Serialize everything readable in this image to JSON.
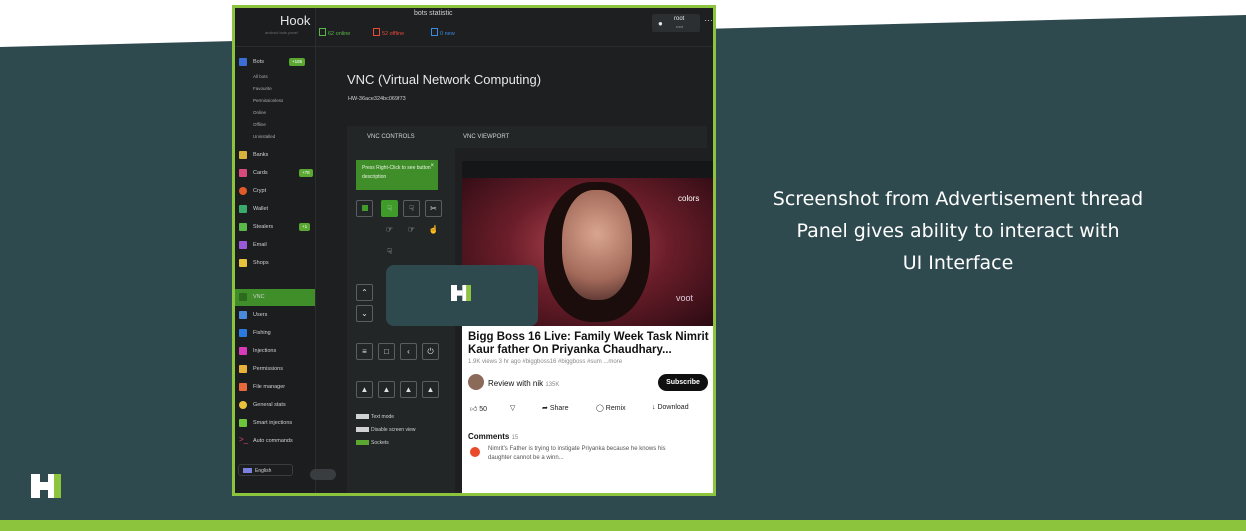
{
  "caption": {
    "line1": "Screenshot from Advertisement thread",
    "line2": "Panel gives ability to interact with",
    "line3": "UI Interface"
  },
  "colors": {
    "background": "#2f4a4f",
    "accent": "#8cc43e",
    "panel": "#1d1f20",
    "active": "#3f8e2a"
  },
  "app": {
    "name": "Hook",
    "subtitle": "android bots panel"
  },
  "topbar": {
    "stats_title": "bots statistic",
    "online": "62 online",
    "offline": "52 offline",
    "new": "0 new",
    "user": "root",
    "user_sub": "root"
  },
  "sidebar": {
    "bots_label": "Bots",
    "bots_badge": "+185",
    "sub_items": [
      "All bots",
      "Favourite",
      "Permissionless",
      "Online",
      "Offline",
      "Uninstalled"
    ],
    "items": [
      {
        "label": "Banks",
        "icon": "bank-icon"
      },
      {
        "label": "Cards",
        "icon": "card-icon",
        "badge": "+78"
      },
      {
        "label": "Crypt",
        "icon": "crypto-icon"
      },
      {
        "label": "Wallet",
        "icon": "wallet-icon"
      },
      {
        "label": "Stealers",
        "icon": "stealer-icon",
        "badge": "+1"
      },
      {
        "label": "Email",
        "icon": "email-icon"
      },
      {
        "label": "Shops",
        "icon": "shop-icon"
      }
    ],
    "items2": [
      {
        "label": "VNC",
        "icon": "vnc-icon"
      },
      {
        "label": "Users",
        "icon": "users-icon"
      },
      {
        "label": "Fishing",
        "icon": "fishing-icon"
      },
      {
        "label": "Injections",
        "icon": "injection-icon"
      },
      {
        "label": "Permissions",
        "icon": "lock-icon"
      },
      {
        "label": "File manager",
        "icon": "folder-icon"
      },
      {
        "label": "General stats",
        "icon": "pie-chart-icon"
      },
      {
        "label": "Smart injections",
        "icon": "smart-injection-icon"
      },
      {
        "label": "Auto commands",
        "icon": "terminal-icon"
      }
    ],
    "language": "English"
  },
  "main": {
    "title": "VNC (Virtual Network Computing)",
    "hwid": "HW-36ace324bc069f73",
    "tab_controls": "VNC CONTROLS",
    "tab_viewport": "VNC VIEWPORT",
    "hint": "Press Right-Click to see button description",
    "checkboxes": [
      "Text mode",
      "Disable screen view",
      "Sockets"
    ]
  },
  "video": {
    "channel_logo": "colors",
    "watermark": "voot",
    "title": "Bigg Boss 16 Live: Family Week Task Nimrit Kaur father On Priyanka Chaudhary...",
    "meta": "1.9K views  3 hr ago  #biggboss16  #biggboss  #sum ...more",
    "channel": "Review with nik",
    "subscribers": "135K",
    "subscribe": "Subscribe",
    "likes": "50",
    "share": "Share",
    "remix": "Remix",
    "download": "Download",
    "comments_label": "Comments",
    "comments_count": "15",
    "comment": "Nimrit's Father is trying to instigate Priyanka because he knows his daughter cannot be a winn..."
  }
}
